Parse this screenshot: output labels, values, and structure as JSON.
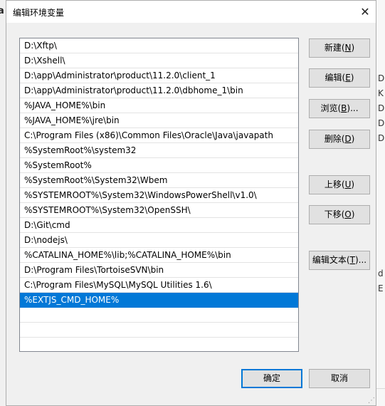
{
  "dialog": {
    "title": "编辑环境变量",
    "close_glyph": "✕"
  },
  "path_entries": [
    "D:\\Xftp\\",
    "D:\\Xshell\\",
    "D:\\app\\Administrator\\product\\11.2.0\\client_1",
    "D:\\app\\Administrator\\product\\11.2.0\\dbhome_1\\bin",
    "%JAVA_HOME%\\bin",
    "%JAVA_HOME%\\jre\\bin",
    "C:\\Program Files (x86)\\Common Files\\Oracle\\Java\\javapath",
    "%SystemRoot%\\system32",
    "%SystemRoot%",
    "%SystemRoot%\\System32\\Wbem",
    "%SYSTEMROOT%\\System32\\WindowsPowerShell\\v1.0\\",
    "%SYSTEMROOT%\\System32\\OpenSSH\\",
    "D:\\Git\\cmd",
    "D:\\nodejs\\",
    "%CATALINA_HOME%\\lib;%CATALINA_HOME%\\bin",
    "D:\\Program Files\\TortoiseSVN\\bin",
    "C:\\Program Files\\MySQL\\MySQL Utilities 1.6\\",
    "%EXTJS_CMD_HOME%"
  ],
  "selected_index": 17,
  "buttons": {
    "new": {
      "text": "新建(",
      "key": "N",
      "end": ")"
    },
    "edit": {
      "text": "编辑(",
      "key": "E",
      "end": ")"
    },
    "browse": {
      "text": "浏览(",
      "key": "B",
      "end": ")..."
    },
    "delete": {
      "text": "删除(",
      "key": "D",
      "end": ")"
    },
    "move_up": {
      "text": "上移(",
      "key": "U",
      "end": ")"
    },
    "move_down": {
      "text": "下移(",
      "key": "O",
      "end": ")"
    },
    "edit_text": {
      "text": "编辑文本(",
      "key": "T",
      "end": ")..."
    },
    "ok": "确定",
    "cancel": "取消"
  },
  "background": {
    "left_char": "a",
    "right_frags": [
      "D",
      "K",
      "D",
      "D",
      "D",
      "d",
      "E"
    ]
  },
  "colors": {
    "selection": "#0078d7",
    "dialog_bg": "#f0f0f0",
    "button_bg": "#e1e1e1"
  }
}
